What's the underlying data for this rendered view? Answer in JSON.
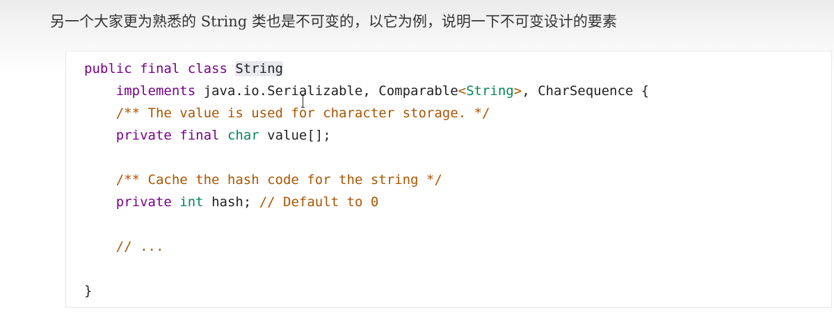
{
  "intro": {
    "before": "另一个大家更为熟悉的 ",
    "code_word": "String",
    "after": " 类也是不可变的，以它为例，说明一下不可变设计的要素"
  },
  "code": {
    "l1_kw": "public final class ",
    "l1_name": "String",
    "l2_indent": "    ",
    "l2_kw": "implements",
    "l2_text": " java.io.Serializable, Comparable",
    "l2_lt": "<",
    "l2_generic": "String",
    "l2_gt": ">",
    "l2_rest": ", CharSequence {",
    "l3_comment": "/** The value is used for character storage. */",
    "l4_kw": "private final",
    "l4_type": "char",
    "l4_rest": " value[];",
    "l6_comment": "/** Cache the hash code for the string */",
    "l7_kw": "private",
    "l7_type": "int",
    "l7_text": " hash; ",
    "l7_comment": "// Default to 0",
    "l9_comment": "// ...",
    "l11_brace": "}"
  }
}
